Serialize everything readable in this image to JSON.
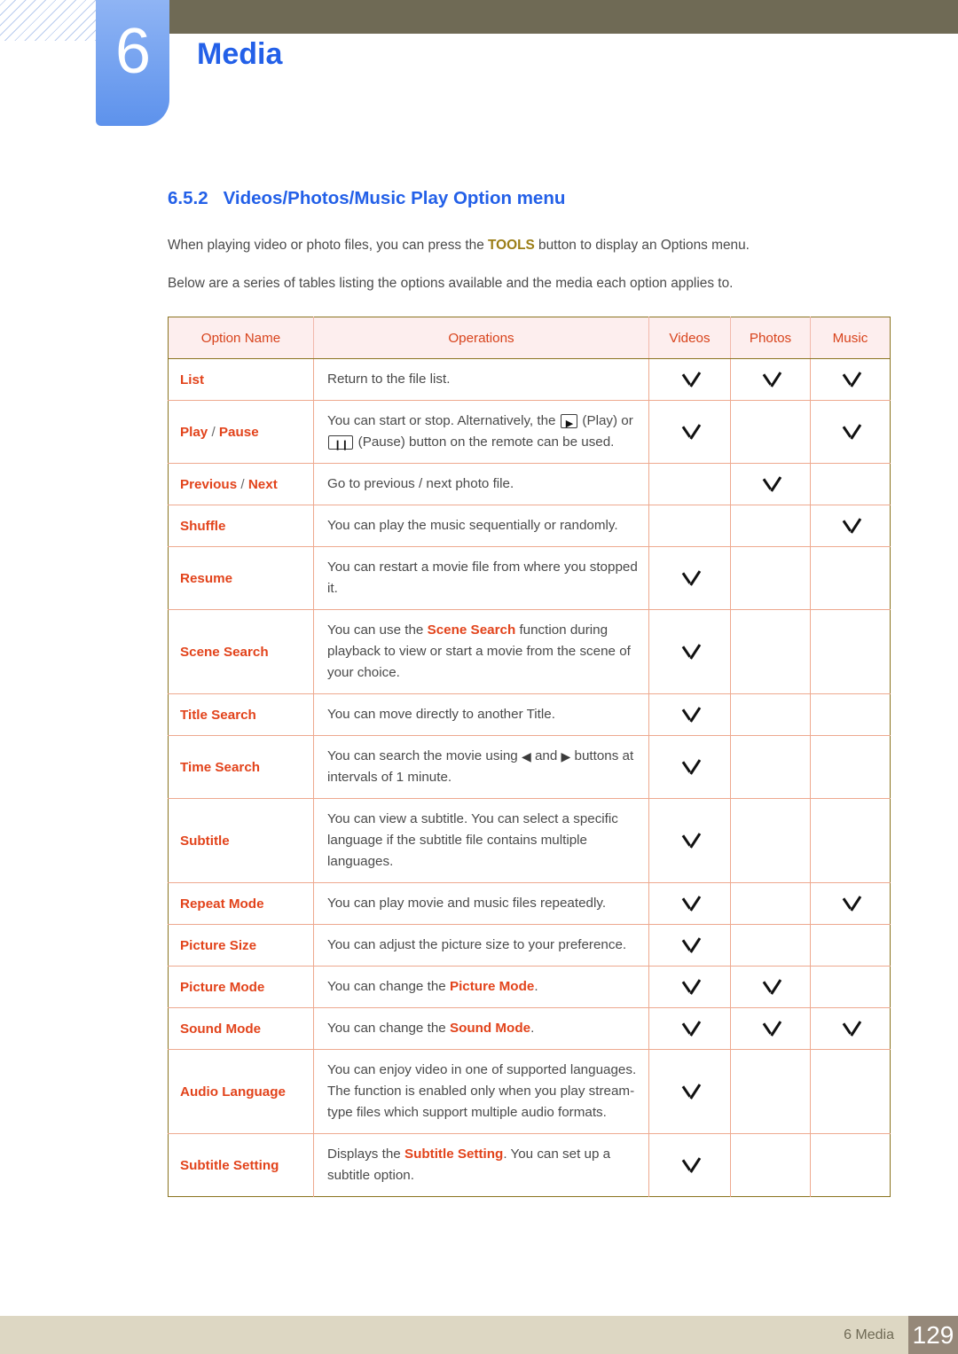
{
  "header": {
    "chapter_number": "6",
    "chapter_title": "Media"
  },
  "section": {
    "number": "6.5.2",
    "title": "Videos/Photos/Music Play Option menu",
    "paragraph_1_before": "When playing video or photo files, you can press the ",
    "paragraph_1_keyword": "TOOLS",
    "paragraph_1_after": " button to display an Options menu.",
    "paragraph_2": "Below are a series of tables listing the options available and the media each option applies to."
  },
  "table": {
    "columns": [
      "Option Name",
      "Operations",
      "Videos",
      "Photos",
      "Music"
    ],
    "rows": [
      {
        "name": "List",
        "name_parts": null,
        "operation": "Return to the file list.",
        "videos": true,
        "photos": true,
        "music": true
      },
      {
        "name": "Play / Pause",
        "name_parts": {
          "first": "Play",
          "sep": " / ",
          "second": "Pause"
        },
        "operation_seg_1": "You can start or stop. Alternatively, the ",
        "icon_play": "play-icon",
        "operation_seg_2": " (Play) or ",
        "icon_pause": "pause-icon",
        "operation_seg_3": " (Pause) button on the remote can be used.",
        "videos": true,
        "photos": false,
        "music": true
      },
      {
        "name": "Previous / Next",
        "name_parts": {
          "first": "Previous",
          "sep": " / ",
          "second": "Next"
        },
        "operation": "Go to previous / next photo file.",
        "videos": false,
        "photos": true,
        "music": false
      },
      {
        "name": "Shuffle",
        "operation": "You can play the music sequentially or randomly.",
        "videos": false,
        "photos": false,
        "music": true
      },
      {
        "name": "Resume",
        "operation": "You can restart a movie file from where you stopped it.",
        "videos": true,
        "photos": false,
        "music": false
      },
      {
        "name": "Scene Search",
        "operation_seg_1": "You can use the ",
        "operation_kw": "Scene Search",
        "operation_seg_2": " function during playback to view or start a movie from the scene of your choice.",
        "videos": true,
        "photos": false,
        "music": false
      },
      {
        "name": "Title Search",
        "operation": "You can move directly to another Title.",
        "videos": true,
        "photos": false,
        "music": false
      },
      {
        "name": "Time Search",
        "operation_seg_1": "You can search the movie using ",
        "icon_left": "◀",
        "operation_seg_2": " and ",
        "icon_right": "▶",
        "operation_seg_3": " buttons at intervals of 1 minute.",
        "videos": true,
        "photos": false,
        "music": false
      },
      {
        "name": "Subtitle",
        "operation": "You can view a subtitle. You can select a specific language if the subtitle file contains multiple languages.",
        "videos": true,
        "photos": false,
        "music": false
      },
      {
        "name": "Repeat Mode",
        "operation": "You can play movie and music files repeatedly.",
        "videos": true,
        "photos": false,
        "music": true
      },
      {
        "name": "Picture Size",
        "operation": "You can adjust the picture size to your preference.",
        "videos": true,
        "photos": false,
        "music": false
      },
      {
        "name": "Picture Mode",
        "operation_seg_1": "You can change the ",
        "operation_kw": "Picture Mode",
        "operation_seg_2": ".",
        "videos": true,
        "photos": true,
        "music": false
      },
      {
        "name": "Sound Mode",
        "operation_seg_1": "You can change the ",
        "operation_kw": "Sound Mode",
        "operation_seg_2": ".",
        "videos": true,
        "photos": true,
        "music": true
      },
      {
        "name": "Audio Language",
        "operation": "You can enjoy video in one of supported languages. The function is enabled only when you play stream-type files which support multiple audio formats.",
        "videos": true,
        "photos": false,
        "music": false
      },
      {
        "name": "Subtitle Setting",
        "operation_seg_1": "Displays the ",
        "operation_kw": "Subtitle Setting",
        "operation_seg_2": ". You can set up a subtitle option.",
        "videos": true,
        "photos": false,
        "music": false
      }
    ]
  },
  "footer": {
    "label": "6 Media",
    "page_number": "129"
  },
  "colors": {
    "chapter_blue": "#5d92ec",
    "heading_blue": "#2360e8",
    "header_bar": "#6f6a55",
    "keyword_orange": "#e2431b",
    "keyword_gold": "#9b7d16",
    "table_header_bg": "#fdeeee",
    "table_outer_border": "#8a7420",
    "table_inner_border": "#eea98f",
    "footer_bg": "#ddd7c3",
    "footer_page_bg": "#958879"
  }
}
